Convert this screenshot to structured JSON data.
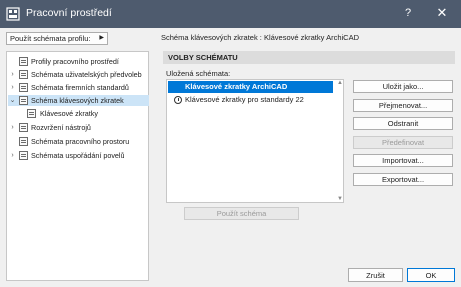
{
  "window": {
    "title": "Pracovní prostředí",
    "help_label": "?",
    "close_label": "✕"
  },
  "profile": {
    "button_label": "Použít schémata profilu:",
    "arrow": "▶"
  },
  "breadcrumb": "Schéma klávesových zkratek : Klávesové zkratky ArchiCAD",
  "tree": {
    "items": [
      {
        "label": "Profily pracovního prostředí",
        "chevron": "",
        "selected": false
      },
      {
        "label": "Schémata uživatelských předvoleb",
        "chevron": "›",
        "selected": false
      },
      {
        "label": "Schémata firemních standardů",
        "chevron": "›",
        "selected": false
      },
      {
        "label": "Schéma klávesových zkratek",
        "chevron": "⌄",
        "selected": true
      },
      {
        "label": "Klávesové zkratky",
        "chevron": "",
        "selected": false
      },
      {
        "label": "Rozvržení nástrojů",
        "chevron": "›",
        "selected": false
      },
      {
        "label": "Schémata pracovního prostoru",
        "chevron": "",
        "selected": false
      },
      {
        "label": "Schémata uspořádání povelů",
        "chevron": "›",
        "selected": false
      }
    ]
  },
  "section": {
    "header": "VOLBY SCHÉMATU",
    "saved_label": "Uložená schémata:"
  },
  "schemas": [
    {
      "label": "Klávesové zkratky ArchiCAD",
      "selected": true
    },
    {
      "label": "Klávesové zkratky pro standardy 22",
      "selected": false
    }
  ],
  "actions": {
    "save_as": "Uložit jako...",
    "rename": "Přejmenovat...",
    "delete": "Odstranit",
    "redefine": "Předefinovat",
    "import": "Importovat...",
    "export": "Exportovat..."
  },
  "apply_label": "Použít schéma",
  "footer": {
    "cancel": "Zrušit",
    "ok": "OK"
  },
  "colors": {
    "titlebar": "#4e5b6e",
    "selection": "#0078d7",
    "tree_selection": "#cce4f7"
  }
}
